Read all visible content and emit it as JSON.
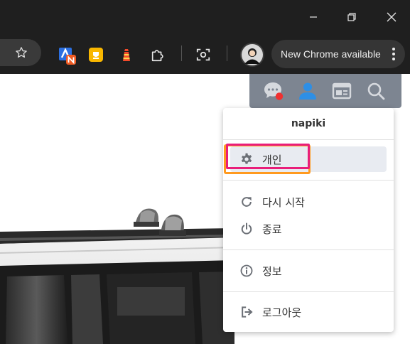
{
  "browser": {
    "new_chrome_label": "New Chrome available"
  },
  "icons": {
    "window_controls": [
      "minimize-icon",
      "restore-icon",
      "close-icon"
    ],
    "toolbar": [
      "bookmark-star-icon",
      "extension-a-n-icon",
      "extension-yellow-note-icon",
      "extension-lighthouse-icon",
      "extensions-puzzle-icon",
      "screenshot-icon"
    ],
    "app_header": [
      "chat-icon",
      "user-icon",
      "card-icon",
      "search-icon"
    ]
  },
  "app_menu": {
    "username": "napiki",
    "items": [
      {
        "label": "개인",
        "icon": "gear-icon"
      },
      {
        "label": "다시 시작",
        "icon": "refresh-icon"
      },
      {
        "label": "종료",
        "icon": "power-icon"
      },
      {
        "label": "정보",
        "icon": "info-icon"
      },
      {
        "label": "로그아웃",
        "icon": "logout-icon"
      }
    ]
  },
  "colors": {
    "chrome_dark": "#1f1f1f",
    "app_header_bg": "#7d8591",
    "active_user_icon": "#2d8fe6",
    "notification_dot": "#f03030",
    "highlight_pink": "#e91e7a",
    "highlight_orange": "#ff9a1f"
  }
}
